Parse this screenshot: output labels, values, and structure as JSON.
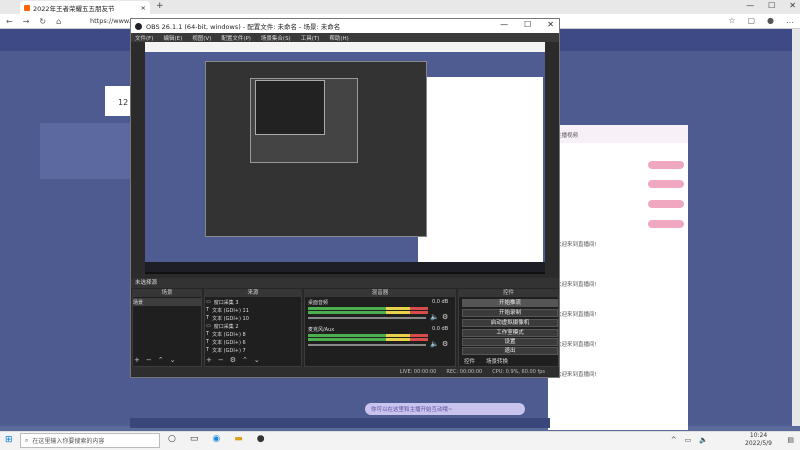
{
  "browser": {
    "tab_title": "2022年王者荣耀五五朋友节",
    "tab_close": "×",
    "new_tab": "+",
    "url": "https://www.douyu",
    "nav": {
      "back": "←",
      "forward": "→",
      "refresh": "↻",
      "home": "⌂"
    },
    "controls": {
      "min": "—",
      "max": "☐",
      "close": "✕"
    }
  },
  "site": {
    "left_number": "12",
    "bullet_placeholder": "你可以在这里和主播开始互动哦~",
    "right_chat": [
      "主播视频",
      "欢迎来到直播间!",
      "欢迎来到直播间!",
      "欢迎来到直播间!",
      "欢迎来到直播间!",
      "欢迎来到直播间!"
    ]
  },
  "obs": {
    "title": "OBS 26.1.1 (64-bit, windows) - 配置文件: 未命名 - 场景: 未命名",
    "menu": [
      "文件(F)",
      "编辑(E)",
      "视图(V)",
      "配置文件(P)",
      "场景集合(S)",
      "工具(T)",
      "帮助(H)"
    ],
    "dock_header": "未选择源",
    "panels": {
      "scenes": "场景",
      "sources": "来源",
      "mixer": "混音器",
      "controls": "控件"
    },
    "scene_item": "场景",
    "sources": [
      "窗口采集 3",
      "文本 (GDI+) 11",
      "文本 (GDI+) 10",
      "窗口采集 2",
      "文本 (GDI+) 8",
      "文本 (GDI+) 6",
      "文本 (GDI+) 7"
    ],
    "mixer": [
      {
        "name": "桌面音频",
        "db": "0.0 dB"
      },
      {
        "name": "麦克风/Aux",
        "db": "0.0 dB"
      }
    ],
    "control_buttons": [
      "开始推流",
      "开始录制",
      "启动虚拟摄像机",
      "工作室模式",
      "设置",
      "退出"
    ],
    "control_tabs": [
      "控件",
      "场景转换"
    ],
    "status": {
      "live": "LIVE: 00:00:00",
      "rec": "REC: 00:00:00",
      "cpu": "CPU: 0.9%, 60.00 fps"
    }
  },
  "taskbar": {
    "search_placeholder": "在这里输入你要搜索的内容",
    "time": "10:24",
    "date": "2022/5/9"
  }
}
